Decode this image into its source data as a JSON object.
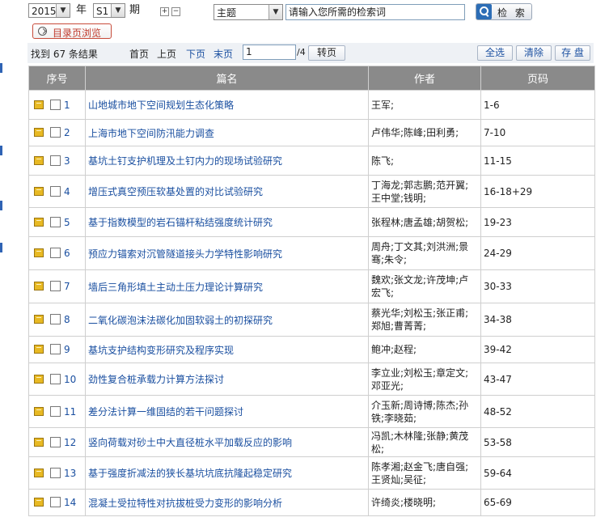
{
  "search": {
    "year": "2015",
    "year_label": "年",
    "issue": "S1",
    "issue_label": "期",
    "field": "主题",
    "keyword_placeholder": "请输入您所需的检索词",
    "search_button": "检 索",
    "directory_button": "目录页浏览"
  },
  "paging": {
    "found": "找到 67 条结果",
    "first": "首页",
    "prev": "上页",
    "next": "下页",
    "last": "末页",
    "page_value": "1",
    "total": "/4",
    "goto": "转页",
    "select_all": "全选",
    "clear": "清除",
    "save": "存 盘"
  },
  "table": {
    "headers": [
      "序号",
      "篇名",
      "作者",
      "页码"
    ],
    "rows": [
      {
        "no": "1",
        "title": "山地城市地下空间规划生态化策略",
        "authors": "王军;",
        "pages": "1-6"
      },
      {
        "no": "2",
        "title": "上海市地下空间防汛能力调查",
        "authors": "卢伟华;陈峰;田利勇;",
        "pages": "7-10"
      },
      {
        "no": "3",
        "title": "基坑土钉支护机理及土钉内力的现场试验研究",
        "authors": "陈飞;",
        "pages": "11-15"
      },
      {
        "no": "4",
        "title": "增压式真空预压软基处置的对比试验研究",
        "authors": "丁海龙;郭志鹏;范开翼;王中堂;钱明;",
        "pages": "16-18+29"
      },
      {
        "no": "5",
        "title": "基于指数模型的岩石锚杆粘结强度统计研究",
        "authors": "张程林;唐孟雄;胡贺松;",
        "pages": "19-23"
      },
      {
        "no": "6",
        "title": "预应力锚索对沉管隧道接头力学特性影响研究",
        "authors": "周舟;丁文其;刘洪洲;景骞;朱令;",
        "pages": "24-29"
      },
      {
        "no": "7",
        "title": "墙后三角形填土主动土压力理论计算研究",
        "authors": "魏欢;张文龙;许茂坤;卢宏飞;",
        "pages": "30-33"
      },
      {
        "no": "8",
        "title": "二氧化碳泡沫法碳化加固软弱土的初探研究",
        "authors": "蔡光华;刘松玉;张正甫;郑旭;曹菁菁;",
        "pages": "34-38"
      },
      {
        "no": "9",
        "title": "基坑支护结构变形研究及程序实现",
        "authors": "鲍冲;赵程;",
        "pages": "39-42"
      },
      {
        "no": "10",
        "title": "劲性复合桩承载力计算方法探讨",
        "authors": "李立业;刘松玉;章定文;邓亚光;",
        "pages": "43-47"
      },
      {
        "no": "11",
        "title": "差分法计算一维固结的若干问题探讨",
        "authors": "介玉新;周诗博;陈杰;孙铁;李晓茹;",
        "pages": "48-52"
      },
      {
        "no": "12",
        "title": "竖向荷载对砂土中大直径桩水平加载反应的影响",
        "authors": "冯凯;木林隆;张静;黄茂松;",
        "pages": "53-58"
      },
      {
        "no": "13",
        "title": "基于强度折减法的狭长基坑坑底抗隆起稳定研究",
        "authors": "陈孝湘;赵金飞;唐自强;王贤灿;吴征;",
        "pages": "59-64"
      },
      {
        "no": "14",
        "title": "混凝土受拉特性对抗拔桩受力变形的影响分析",
        "authors": "许绮炎;楼晓明;",
        "pages": "65-69"
      }
    ]
  }
}
